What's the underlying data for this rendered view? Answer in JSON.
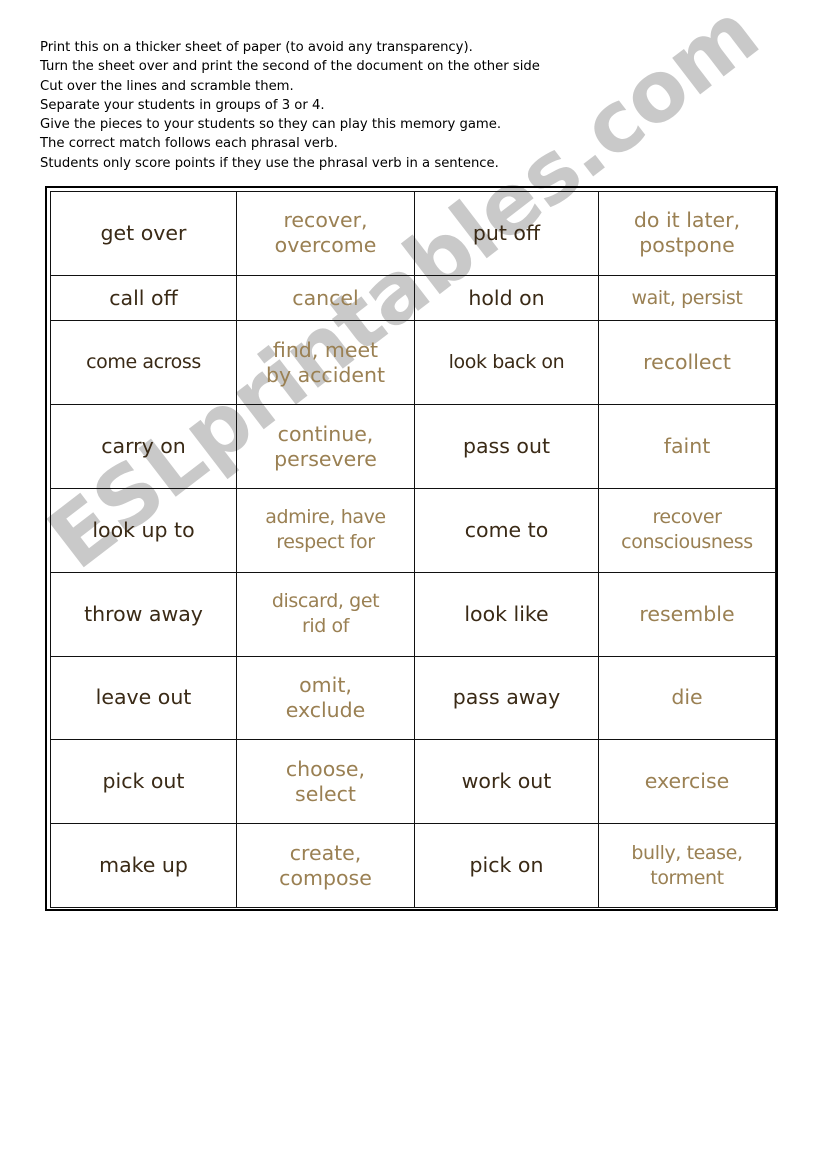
{
  "document": {
    "title": "Phrasal Verbs Memory Game"
  },
  "watermark": {
    "text": "ESLprintables.com",
    "color": "#c9c9c9"
  },
  "instructions": {
    "lines": [
      "Print this on a thicker sheet of paper (to avoid any transparency).",
      "Turn the sheet over and print the second of the document on the other side",
      "Cut over the lines and scramble them.",
      "Separate your students in groups of 3 or 4.",
      "Give the pieces to your students so they can play this memory game.",
      "The correct match follows each phrasal verb.",
      "Students only score points if they use the phrasal verb in a sentence."
    ]
  },
  "colors": {
    "verb_text": "#3a2a16",
    "definition_text": "#9a8053",
    "border": "#111111",
    "page_background": "#ffffff"
  },
  "card_table": {
    "rows": [
      {
        "verb_a": "get over",
        "def_a": "recover,\novercome",
        "verb_b": "put off",
        "def_b": "do it later,\npostpone"
      },
      {
        "verb_a": "call off",
        "def_a": "cancel",
        "verb_b": "hold on",
        "def_b": "wait, persist"
      },
      {
        "verb_a": "come across",
        "def_a": "find, meet\nby accident",
        "verb_b": "look back on",
        "def_b": "recollect"
      },
      {
        "verb_a": "carry on",
        "def_a": "continue,\npersevere",
        "verb_b": "pass out",
        "def_b": "faint"
      },
      {
        "verb_a": "look up to",
        "def_a": "admire, have\nrespect for",
        "verb_b": "come to",
        "def_b": "recover\nconsciousness"
      },
      {
        "verb_a": "throw away",
        "def_a": "discard, get\nrid of",
        "verb_b": "look like",
        "def_b": "resemble"
      },
      {
        "verb_a": "leave out",
        "def_a": "omit,\nexclude",
        "verb_b": "pass away",
        "def_b": "die"
      },
      {
        "verb_a": "pick out",
        "def_a": "choose,\nselect",
        "verb_b": "work out",
        "def_b": "exercise"
      },
      {
        "verb_a": "make up",
        "def_a": "create,\ncompose",
        "verb_b": "pick on",
        "def_b": "bully, tease,\ntorment"
      }
    ]
  }
}
